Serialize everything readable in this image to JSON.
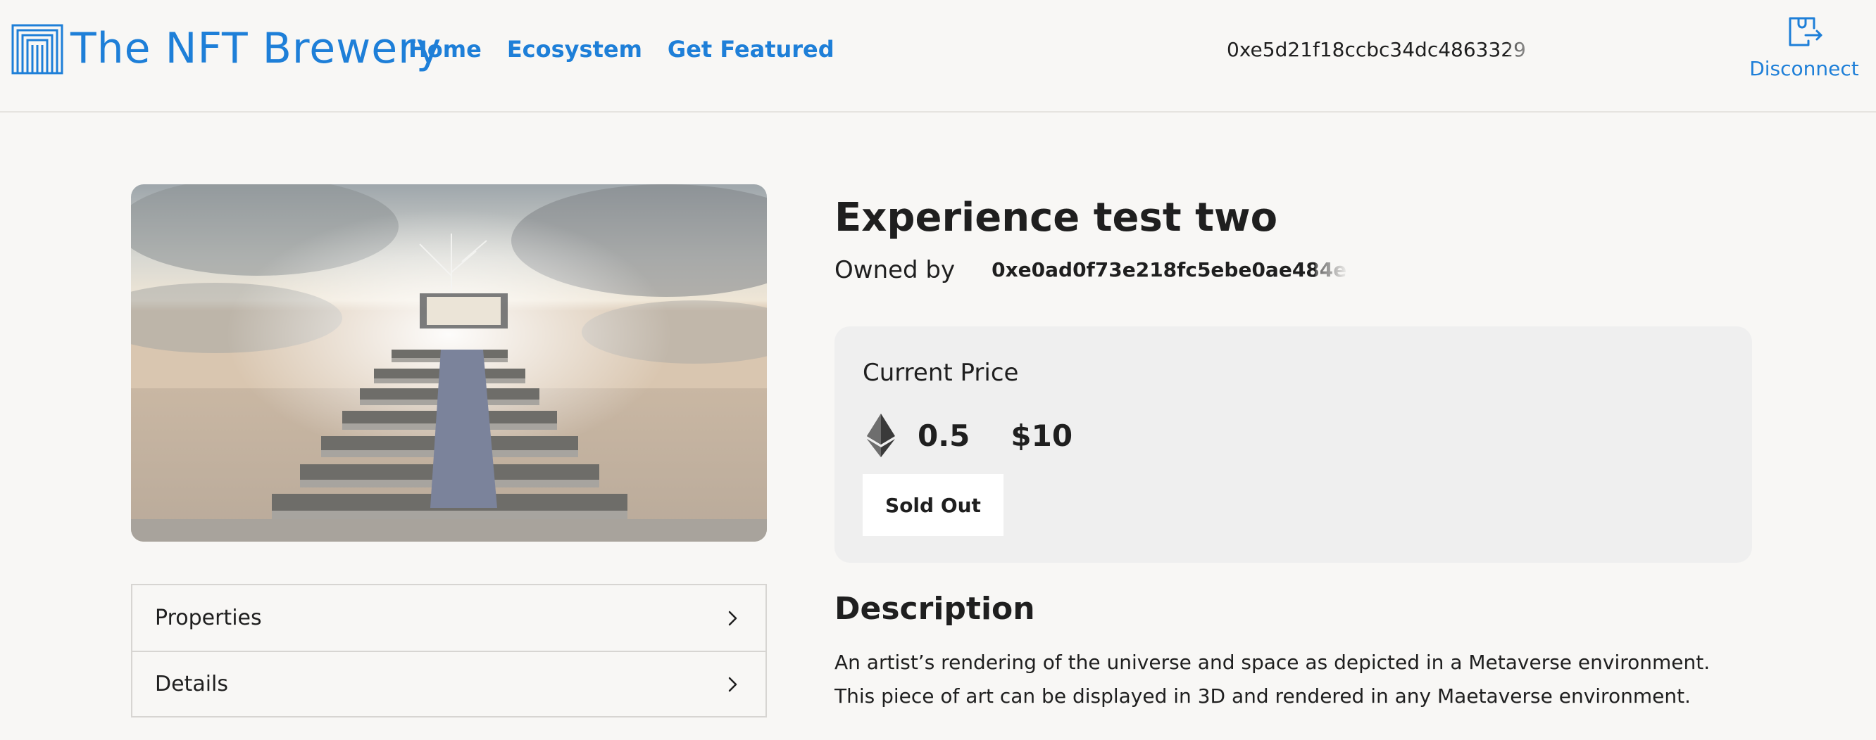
{
  "header": {
    "logo_text": "The NFT Brewery",
    "logo_icon": "columns-logo-icon",
    "nav": [
      {
        "label": "Home"
      },
      {
        "label": "Ecosystem"
      },
      {
        "label": "Get Featured"
      }
    ],
    "wallet_address": "0xe5d21f18ccbc34dc4863329",
    "disconnect_label": "Disconnect",
    "disconnect_icon": "wallet-exit-icon"
  },
  "nft": {
    "title": "Experience test two",
    "owned_by_label": "Owned by",
    "owner_address": "0xe0ad0f73e218fc5ebe0ae484e"
  },
  "price": {
    "label": "Current Price",
    "currency_icon": "ethereum-icon",
    "eth_value": "0.5",
    "usd_value": "$10",
    "button_label": "Sold Out"
  },
  "accordion": [
    {
      "label": "Properties",
      "icon": "chevron-right-icon"
    },
    {
      "label": "Details",
      "icon": "chevron-right-icon"
    }
  ],
  "description": {
    "heading": "Description",
    "text": "An artist’s rendering of the universe and space as depicted in a Metaverse environment. This piece of art can be displayed in 3D and rendered in any Maetaverse environment."
  },
  "colors": {
    "accent": "#1e7fd8",
    "background": "#f8f7f5",
    "price_box": "#efefef",
    "text": "#1f1f1f"
  }
}
